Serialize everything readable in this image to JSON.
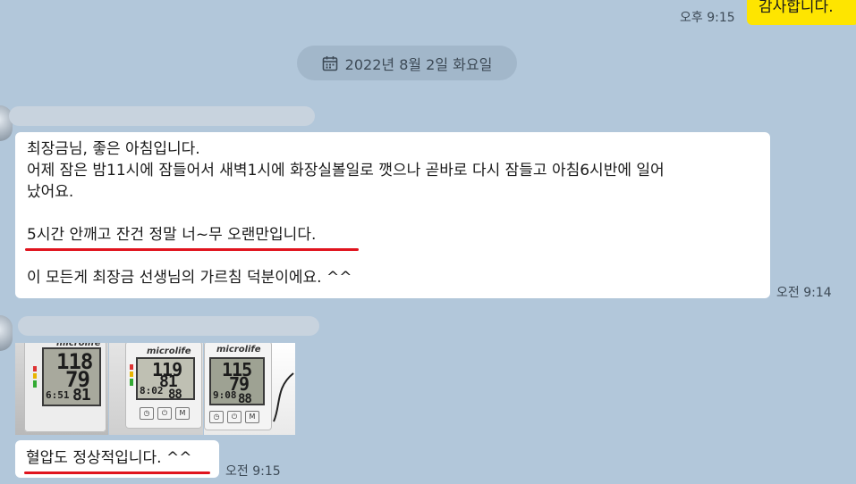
{
  "sent_message": {
    "text": "감사합니다.",
    "time": "오후 9:15"
  },
  "date_divider": {
    "icon": "calendar-icon",
    "text": "2022년 8월 2일 화요일"
  },
  "message1": {
    "lines": [
      "최장금님, 좋은 아침입니다.",
      "어제 잠은 밤11시에 잠들어서 새벽1시에 화장실볼일로 깻으나 곧바로 다시 잠들고 아침6시반에 일어",
      "났어요.",
      "",
      "5시간 안깨고 잔건 정말 너~무 오랜만입니다.",
      "",
      "이 모든게 최장금 선생님의 가르침 덕분이에요. ^^"
    ],
    "time": "오전 9:14",
    "underline_color": "#e0141e"
  },
  "photos": [
    {
      "brand": "microlife",
      "sys": "118",
      "dia": "79",
      "time": "6:51",
      "pulse": "81"
    },
    {
      "brand": "microlife",
      "sys": "119",
      "dia": "81",
      "time": "8:02",
      "pulse": "88"
    },
    {
      "brand": "microlife",
      "sys": "115",
      "dia": "79",
      "time": "9:08",
      "pulse": "88"
    }
  ],
  "message2": {
    "text": "혈압도 정상적입니다. ^^",
    "time": "오전 9:15"
  },
  "colors": {
    "background": "#b2c7da",
    "sent_bubble": "#fee500",
    "received_bubble": "#ffffff"
  }
}
